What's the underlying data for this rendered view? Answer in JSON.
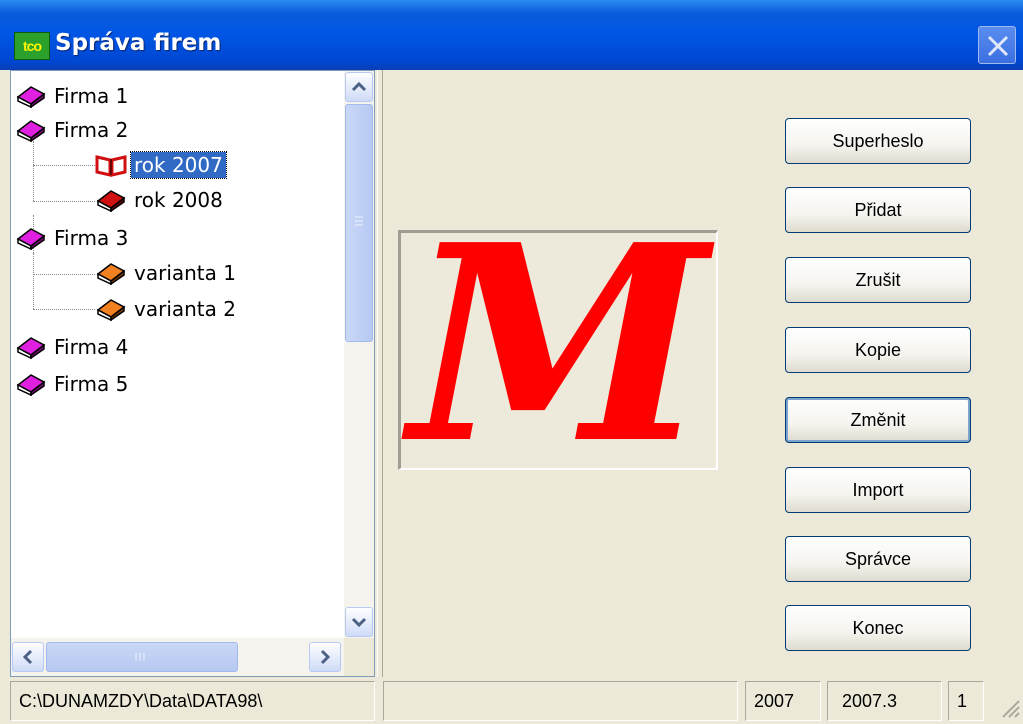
{
  "window": {
    "title": "Správa firem",
    "icon_text": "tco"
  },
  "tree": {
    "items": [
      {
        "label": "Firma 1",
        "icon": "book-closed-magenta-icon",
        "level": 0
      },
      {
        "label": "Firma 2",
        "icon": "book-closed-magenta-icon",
        "level": 0
      },
      {
        "label": "rok 2007",
        "icon": "book-open-red-icon",
        "level": 1,
        "selected": true
      },
      {
        "label": "rok 2008",
        "icon": "book-closed-red-icon",
        "level": 1
      },
      {
        "label": "Firma 3",
        "icon": "book-closed-magenta-icon",
        "level": 0
      },
      {
        "label": "varianta  1",
        "icon": "book-closed-orange-icon",
        "level": 1
      },
      {
        "label": "varianta  2",
        "icon": "book-closed-orange-icon",
        "level": 1
      },
      {
        "label": "Firma 4",
        "icon": "book-closed-magenta-icon",
        "level": 0
      },
      {
        "label": "Firma 5",
        "icon": "book-closed-magenta-icon",
        "level": 0
      }
    ]
  },
  "logo": {
    "letter": "M",
    "color": "#FF0000"
  },
  "buttons": {
    "superheslo": "Superheslo",
    "pridat": "Přidat",
    "zrusit": "Zrušit",
    "kopie": "Kopie",
    "zmenit": "Změnit",
    "import": "Import",
    "spravce": "Správce",
    "konec": "Konec"
  },
  "statusbar": {
    "path": "C:\\DUNAMZDY\\Data\\DATA98\\",
    "empty": "",
    "year": "2007",
    "version": "2007.3",
    "number": "1"
  },
  "colors": {
    "titlebar": "#0055E5",
    "selection": "#316AC5",
    "magenta_book": "#E020E0",
    "red_book": "#D01010",
    "orange_book": "#F08020"
  }
}
